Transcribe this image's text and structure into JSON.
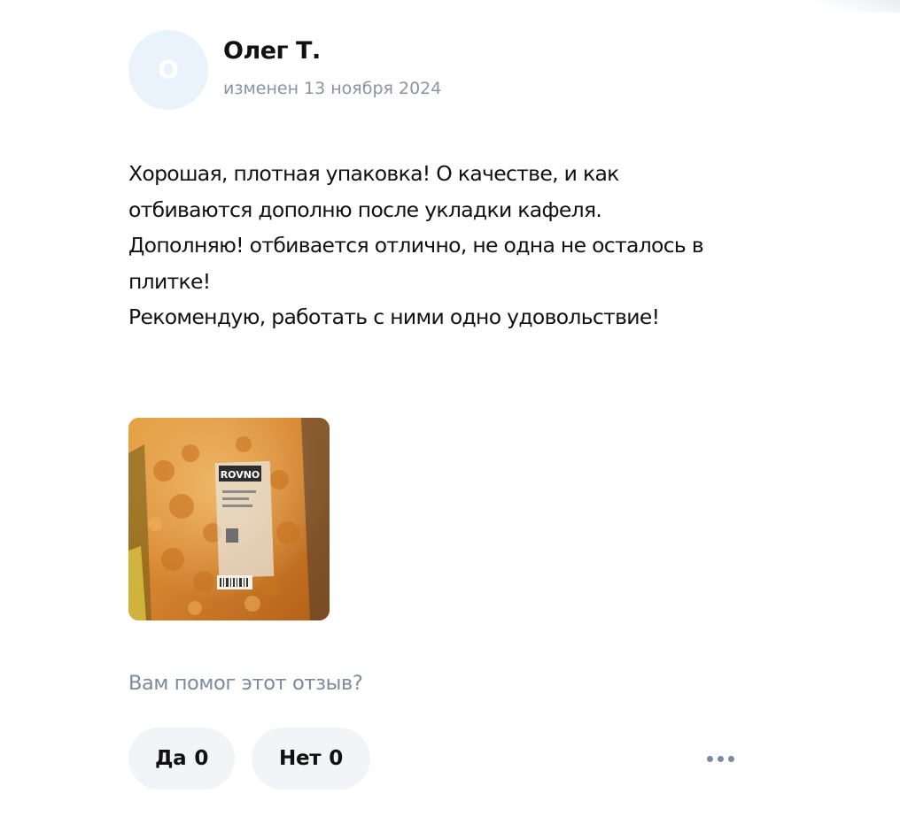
{
  "review": {
    "author": {
      "initial": "О",
      "name": "Олег Т."
    },
    "date": "изменен 13 ноября 2024",
    "text_lines": [
      "Хорошая, плотная упаковка! О качестве, и как отбиваются дополню после укладки кафеля.",
      "Дополняю! отбивается отлично, не одна не осталось в плитке!",
      "Рекомендую, работать с ними одно удовольствие!"
    ],
    "photo": {
      "label": "ROVNO"
    }
  },
  "helpful": {
    "question": "Вам помог этот отзыв?",
    "yes_label": "Да",
    "yes_count": "0",
    "no_label": "Нет",
    "no_count": "0"
  },
  "colors": {
    "avatar_bg": "#eaf2fb",
    "muted_text": "#8a94a3",
    "button_bg": "#f2f4f7",
    "photo_orange": "#c97521"
  },
  "icons": {
    "more": "more-dots-icon"
  }
}
